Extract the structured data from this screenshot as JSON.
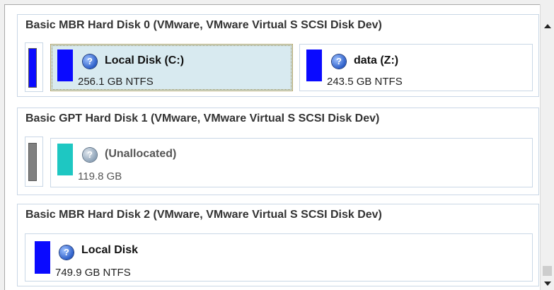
{
  "disks": [
    {
      "title": "Basic MBR Hard Disk 0 (VMware, VMware Virtual S SCSI Disk Dev)",
      "partitions": [
        {
          "name": "Local Disk (C:)",
          "size": "256.1 GB NTFS",
          "selected": true,
          "icon": "question-icon"
        },
        {
          "name": "data (Z:)",
          "size": "243.5 GB NTFS",
          "selected": false,
          "icon": "question-icon"
        }
      ]
    },
    {
      "title": "Basic GPT Hard Disk 1 (VMware, VMware Virtual S SCSI Disk Dev)",
      "partitions": [
        {
          "name": "(Unallocated)",
          "size": "119.8 GB",
          "selected": false,
          "icon": "question-icon"
        }
      ]
    },
    {
      "title": "Basic MBR Hard Disk 2 (VMware, VMware Virtual S SCSI Disk Dev)",
      "partitions": [
        {
          "name": "Local Disk",
          "size": "749.9 GB NTFS",
          "selected": false,
          "icon": "question-icon"
        }
      ]
    }
  ],
  "colors": {
    "ntfs_bar": "#0a0aff",
    "unallocated_bar": "#1ec7c2",
    "gpt_bar": "#808080",
    "selected_bg": "#d8eaf0",
    "border": "#c9d7e6"
  }
}
